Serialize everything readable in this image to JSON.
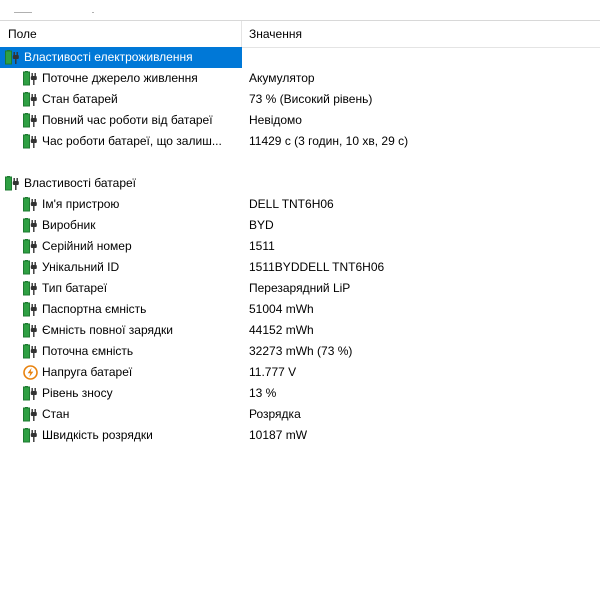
{
  "columns": {
    "field": "Поле",
    "value": "Значення"
  },
  "power": {
    "title": "Властивості електроживлення",
    "items": [
      {
        "label": "Поточне джерело живлення",
        "value": "Акумулятор",
        "icon": "battery-icon"
      },
      {
        "label": "Стан батарей",
        "value": "73 % (Високий рівень)",
        "icon": "battery-icon"
      },
      {
        "label": "Повний час роботи від батареї",
        "value": "Невідомо",
        "icon": "battery-icon"
      },
      {
        "label": "Час роботи батареї, що залиш...",
        "value": "11429 с (3 годин, 10 хв, 29 с)",
        "icon": "battery-icon"
      }
    ]
  },
  "battery": {
    "title": "Властивості батареї",
    "items": [
      {
        "label": "Ім'я пристрою",
        "value": "DELL TNT6H06",
        "icon": "battery-icon"
      },
      {
        "label": "Виробник",
        "value": "BYD",
        "icon": "battery-icon"
      },
      {
        "label": "Серійний номер",
        "value": "1511",
        "icon": "battery-icon"
      },
      {
        "label": "Унікальний ID",
        "value": "1511BYDDELL TNT6H06",
        "icon": "battery-icon"
      },
      {
        "label": "Тип батареї",
        "value": "Перезарядний LiP",
        "icon": "battery-icon"
      },
      {
        "label": "Паспортна ємність",
        "value": "51004 mWh",
        "icon": "battery-icon"
      },
      {
        "label": "Ємність повної зарядки",
        "value": "44152 mWh",
        "icon": "battery-icon"
      },
      {
        "label": "Поточна ємність",
        "value": "32273 mWh  (73 %)",
        "icon": "battery-icon"
      },
      {
        "label": "Напруга батареї",
        "value": "11.777 V",
        "icon": "voltage-icon"
      },
      {
        "label": "Рівень зносу",
        "value": "13 %",
        "icon": "battery-icon"
      },
      {
        "label": "Стан",
        "value": "Розрядка",
        "icon": "battery-icon"
      },
      {
        "label": "Швидкість розрядки",
        "value": "10187 mW",
        "icon": "battery-icon"
      }
    ]
  },
  "colors": {
    "selection": "#0078d7",
    "battery_green": "#2fa043",
    "voltage_orange": "#e8820e"
  }
}
